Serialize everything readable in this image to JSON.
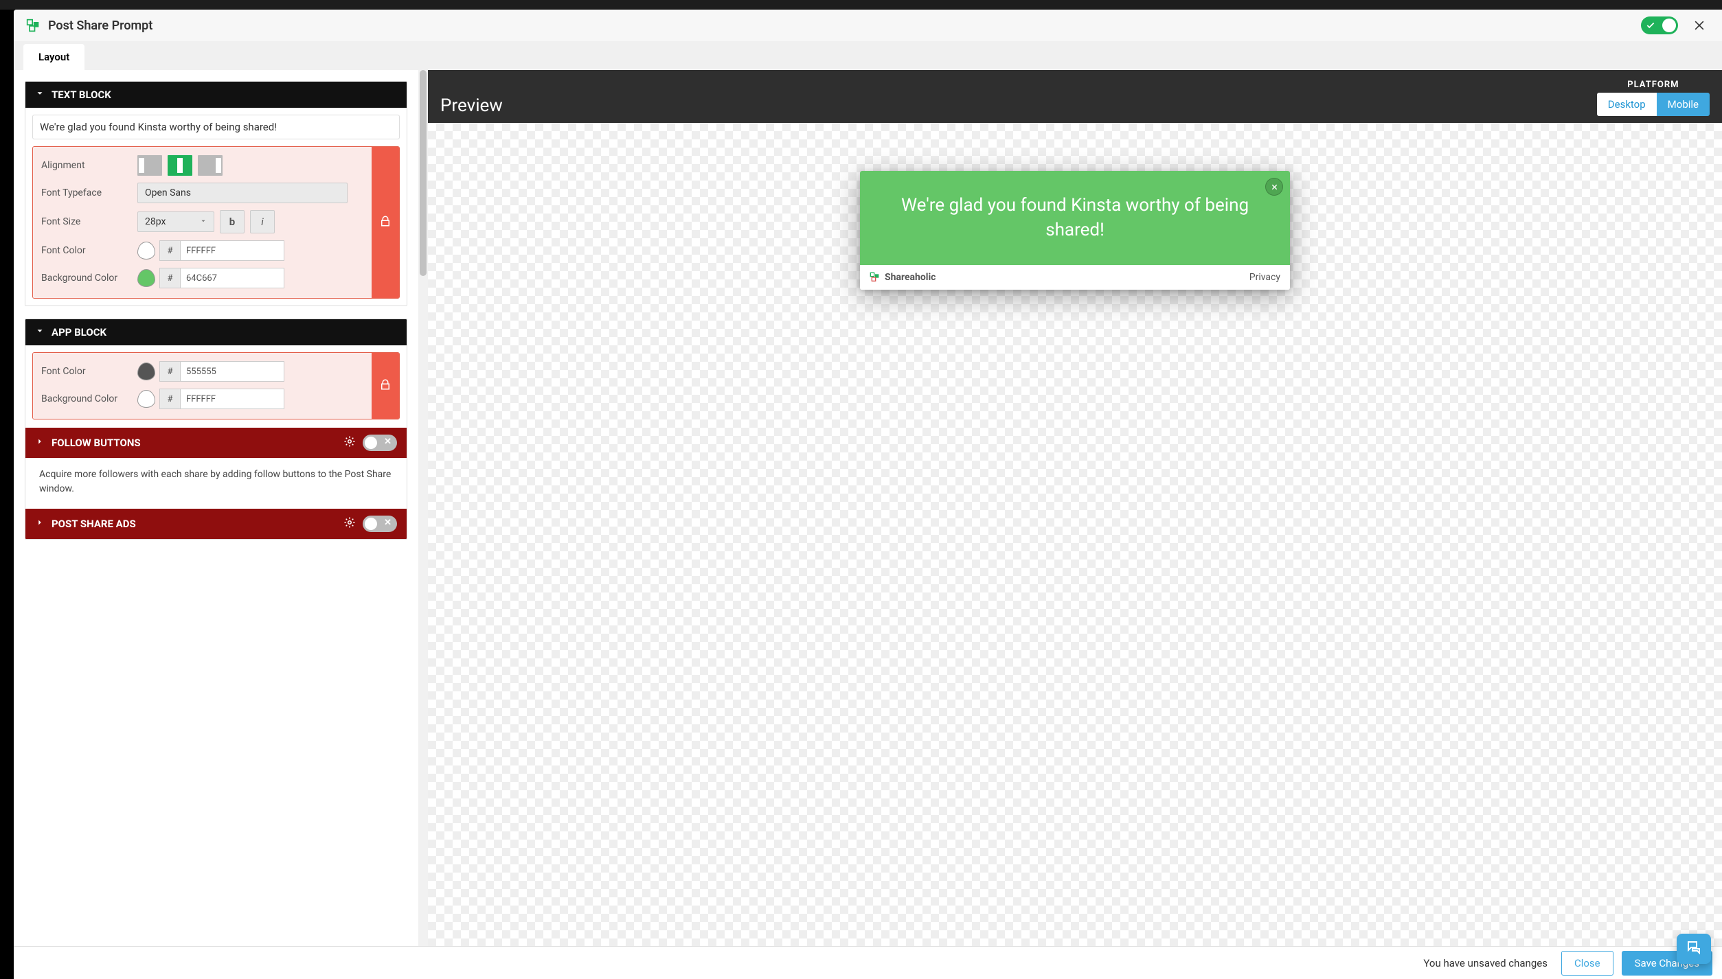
{
  "header": {
    "title": "Post Share Prompt"
  },
  "tabs": {
    "layout": "Layout"
  },
  "textBlock": {
    "title": "TEXT BLOCK",
    "message": "We're glad you found Kinsta worthy of being shared!",
    "labels": {
      "alignment": "Alignment",
      "typeface": "Font Typeface",
      "size": "Font Size",
      "fontColor": "Font Color",
      "bgColor": "Background Color"
    },
    "typeface": "Open Sans",
    "size": "28px",
    "boldLabel": "b",
    "italicLabel": "i",
    "hash": "#",
    "fontColor": "FFFFFF",
    "bgColor": "64C667"
  },
  "appBlock": {
    "title": "APP BLOCK",
    "labels": {
      "fontColor": "Font Color",
      "bgColor": "Background Color"
    },
    "hash": "#",
    "fontColor": "555555",
    "bgColor": "FFFFFF"
  },
  "followButtons": {
    "title": "FOLLOW BUTTONS",
    "desc": "Acquire more followers with each share by adding follow buttons to the Post Share window."
  },
  "postShareAds": {
    "title": "POST SHARE ADS"
  },
  "preview": {
    "title": "Preview",
    "platformLabel": "PLATFORM",
    "desktop": "Desktop",
    "mobile": "Mobile",
    "brand": "Shareaholic",
    "privacy": "Privacy"
  },
  "footer": {
    "unsaved": "You have unsaved changes",
    "close": "Close",
    "save": "Save Changes"
  }
}
